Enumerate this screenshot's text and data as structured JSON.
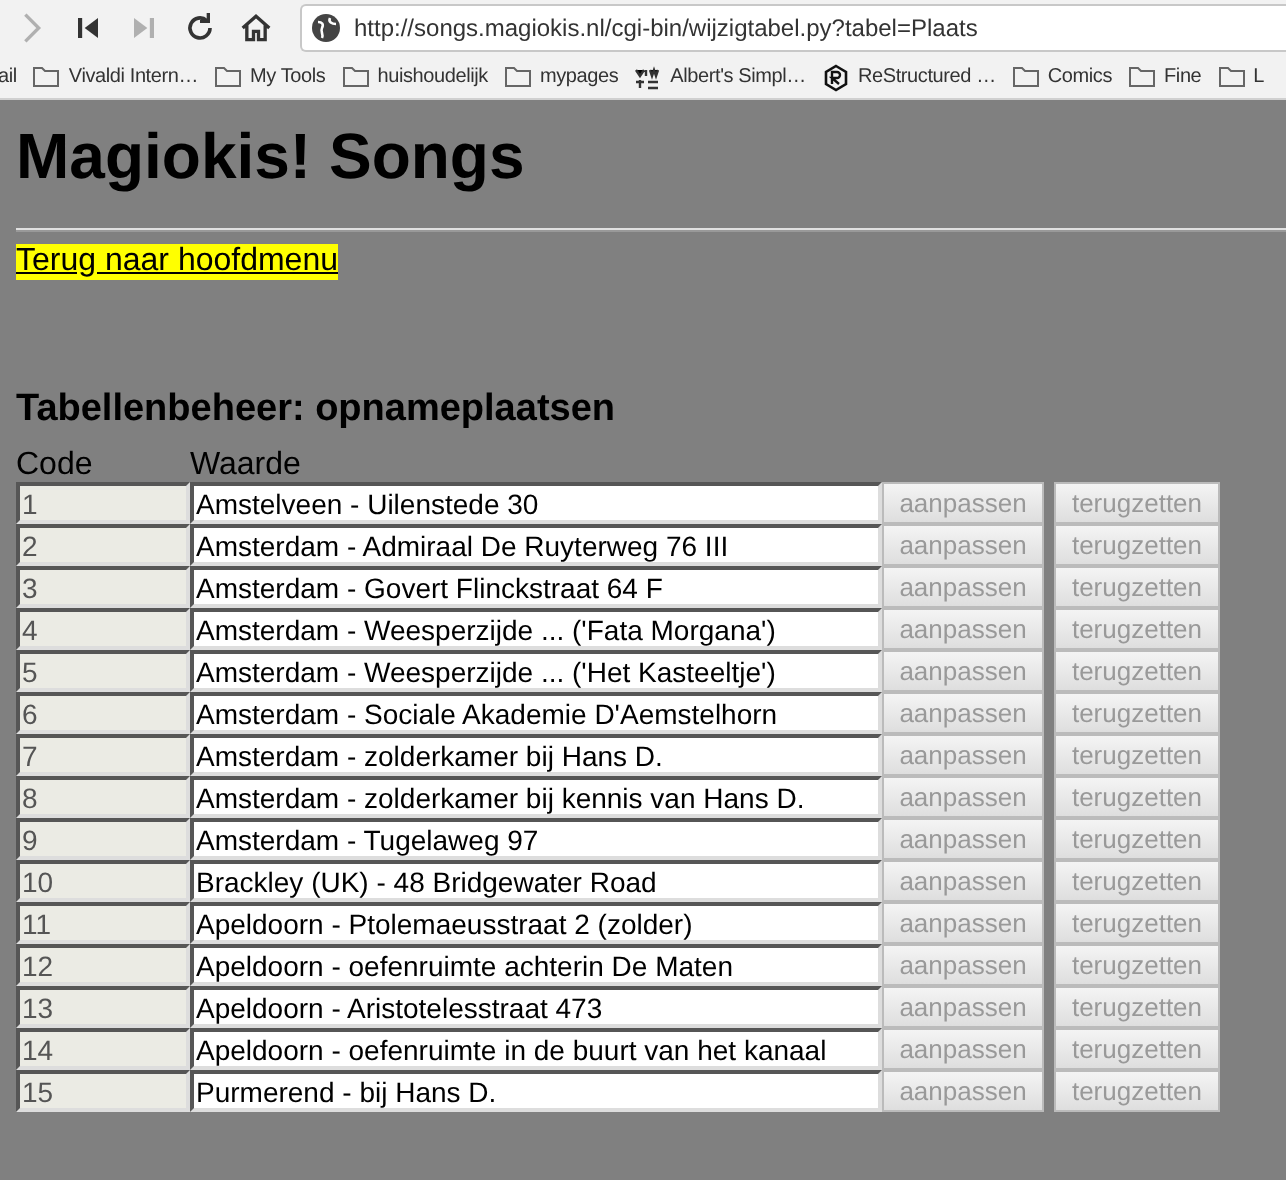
{
  "browser": {
    "nav_buttons": [
      {
        "kind": "forward",
        "disabled": true
      },
      {
        "kind": "first",
        "disabled": false
      },
      {
        "kind": "last",
        "disabled": true
      },
      {
        "kind": "reload",
        "disabled": false
      },
      {
        "kind": "home",
        "disabled": false
      }
    ],
    "url": "http://songs.magiokis.nl/cgi-bin/wijzigtabel.py?tabel=Plaats",
    "bookmarks": [
      {
        "label": "ail",
        "kind": "none"
      },
      {
        "label": "Vivaldi Intern…",
        "kind": "folder"
      },
      {
        "label": "My Tools",
        "kind": "folder"
      },
      {
        "label": "huishoudelijk",
        "kind": "folder"
      },
      {
        "label": "mypages",
        "kind": "folder"
      },
      {
        "label": "Albert's Simpl…",
        "kind": "site"
      },
      {
        "label": "ReStructured …",
        "kind": "badge"
      },
      {
        "label": "Comics",
        "kind": "folder"
      },
      {
        "label": "Fine",
        "kind": "folder"
      },
      {
        "label": "L",
        "kind": "folder"
      }
    ]
  },
  "page": {
    "title": "Magiokis! Songs",
    "back_link": "Terug naar hoofdmenu",
    "heading": "Tabellenbeheer: opnameplaatsen",
    "table": {
      "columns": [
        "Code",
        "Waarde"
      ],
      "rows": [
        {
          "code": "1",
          "value": "Amstelveen - Uilenstede 30",
          "buttons": [
            {
              "label": "aanpassen",
              "disabled": true
            },
            {
              "label": "terugzetten",
              "disabled": true
            }
          ]
        },
        {
          "code": "2",
          "value": "Amsterdam - Admiraal De Ruyterweg 76 III",
          "buttons": [
            {
              "label": "aanpassen",
              "disabled": true
            },
            {
              "label": "terugzetten",
              "disabled": true
            }
          ]
        },
        {
          "code": "3",
          "value": "Amsterdam - Govert Flinckstraat 64 F",
          "buttons": [
            {
              "label": "aanpassen",
              "disabled": true
            },
            {
              "label": "terugzetten",
              "disabled": true
            }
          ]
        },
        {
          "code": "4",
          "value": "Amsterdam - Weesperzijde ... ('Fata Morgana')",
          "buttons": [
            {
              "label": "aanpassen",
              "disabled": true
            },
            {
              "label": "terugzetten",
              "disabled": true
            }
          ]
        },
        {
          "code": "5",
          "value": "Amsterdam - Weesperzijde ... ('Het Kasteeltje')",
          "buttons": [
            {
              "label": "aanpassen",
              "disabled": true
            },
            {
              "label": "terugzetten",
              "disabled": true
            }
          ]
        },
        {
          "code": "6",
          "value": "Amsterdam - Sociale Akademie D'Aemstelhorn",
          "buttons": [
            {
              "label": "aanpassen",
              "disabled": true
            },
            {
              "label": "terugzetten",
              "disabled": true
            }
          ]
        },
        {
          "code": "7",
          "value": "Amsterdam - zolderkamer bij Hans D.",
          "buttons": [
            {
              "label": "aanpassen",
              "disabled": true
            },
            {
              "label": "terugzetten",
              "disabled": true
            }
          ]
        },
        {
          "code": "8",
          "value": "Amsterdam - zolderkamer bij kennis van Hans D.",
          "buttons": [
            {
              "label": "aanpassen",
              "disabled": true
            },
            {
              "label": "terugzetten",
              "disabled": true
            }
          ]
        },
        {
          "code": "9",
          "value": "Amsterdam - Tugelaweg 97",
          "buttons": [
            {
              "label": "aanpassen",
              "disabled": true
            },
            {
              "label": "terugzetten",
              "disabled": true
            }
          ]
        },
        {
          "code": "10",
          "value": "Brackley (UK) - 48 Bridgewater Road",
          "buttons": [
            {
              "label": "aanpassen",
              "disabled": true
            },
            {
              "label": "terugzetten",
              "disabled": true
            }
          ]
        },
        {
          "code": "11",
          "value": "Apeldoorn - Ptolemaeusstraat 2 (zolder)",
          "buttons": [
            {
              "label": "aanpassen",
              "disabled": true
            },
            {
              "label": "terugzetten",
              "disabled": true
            }
          ]
        },
        {
          "code": "12",
          "value": "Apeldoorn - oefenruimte achterin De Maten",
          "buttons": [
            {
              "label": "aanpassen",
              "disabled": true
            },
            {
              "label": "terugzetten",
              "disabled": true
            }
          ]
        },
        {
          "code": "13",
          "value": "Apeldoorn - Aristotelesstraat 473",
          "buttons": [
            {
              "label": "aanpassen",
              "disabled": true
            },
            {
              "label": "terugzetten",
              "disabled": true
            }
          ]
        },
        {
          "code": "14",
          "value": "Apeldoorn - oefenruimte in de buurt van het kanaal",
          "buttons": [
            {
              "label": "aanpassen",
              "disabled": true
            },
            {
              "label": "terugzetten",
              "disabled": true
            }
          ]
        },
        {
          "code": "15",
          "value": "Purmerend - bij Hans D.",
          "buttons": [
            {
              "label": "aanpassen",
              "disabled": true
            },
            {
              "label": "terugzetten",
              "disabled": true
            }
          ]
        }
      ]
    }
  }
}
